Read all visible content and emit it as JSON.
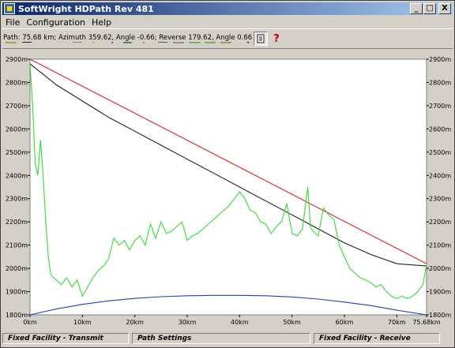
{
  "window": {
    "title": "SoftWright HDPath Rev 481",
    "buttons": {
      "minimize": "_",
      "maximize": "□",
      "close": "X"
    }
  },
  "menu": [
    "File",
    "Configuration",
    "Help"
  ],
  "toolbar": {
    "icons": [
      "new-icon",
      "save-icon",
      "print-icon",
      "edit-icon",
      "record-icon",
      "line-icon",
      "center-icon",
      "expand-icon",
      "locate-icon",
      "map-icon",
      "terrain-icon",
      "layer-a-icon",
      "layer-b-icon",
      "layer-c-icon",
      "zoom-icon",
      "page-icon",
      "help-icon"
    ],
    "help_glyph": "?"
  },
  "path_info": "Path: 75.68 km; Azimuth 359.62, Angle -0.66; Reverse 179.62, Angle 0.66",
  "chart_data": {
    "type": "line",
    "x_unit": "km",
    "y_unit": "m",
    "xlim": [
      0,
      75.68
    ],
    "ylim": [
      1800,
      2900
    ],
    "x_ticks": [
      "0km",
      "10km",
      "20km",
      "30km",
      "40km",
      "50km",
      "60km",
      "70km",
      "75.68km"
    ],
    "y_ticks": [
      "2900m",
      "2800m",
      "2700m",
      "2600m",
      "2500m",
      "2400m",
      "2300m",
      "2200m",
      "2100m",
      "2000m",
      "1900m",
      "1800m"
    ],
    "grid": false,
    "colors": {
      "line_of_sight": "#e02020",
      "earth_curve": "#202020",
      "terrain": "#33dd33",
      "fresnel": "#2040c0"
    },
    "series": [
      {
        "key": "line_of_sight",
        "x": [
          0,
          75.68
        ],
        "y": [
          2900,
          2020
        ]
      },
      {
        "key": "earth_curve",
        "x": [
          0,
          5,
          10,
          15,
          20,
          25,
          30,
          35,
          40,
          45,
          50,
          55,
          60,
          65,
          70,
          75.68
        ],
        "y": [
          2880,
          2790,
          2720,
          2650,
          2590,
          2530,
          2470,
          2410,
          2350,
          2290,
          2230,
          2170,
          2110,
          2060,
          2020,
          2010
        ]
      },
      {
        "key": "terrain",
        "x": [
          0,
          0.5,
          1,
          1.5,
          2,
          2.5,
          3,
          3.5,
          4,
          5,
          6,
          7,
          8,
          9,
          10,
          11,
          12,
          13,
          14,
          15,
          16,
          17,
          18,
          19,
          20,
          21,
          22,
          23,
          24,
          25,
          26,
          27,
          28,
          29,
          30,
          31,
          32,
          33,
          34,
          35,
          36,
          37,
          38,
          39,
          40,
          41,
          42,
          43,
          44,
          45,
          46,
          47,
          48,
          49,
          50,
          51,
          52,
          53,
          53.5,
          54,
          55,
          56,
          57,
          58,
          59,
          60,
          61,
          62,
          63,
          64,
          65,
          66,
          67,
          68,
          69,
          70,
          71,
          72,
          73,
          74,
          75,
          75.68
        ],
        "y": [
          2880,
          2700,
          2450,
          2400,
          2550,
          2400,
          2200,
          2050,
          1970,
          1950,
          1930,
          1960,
          1920,
          1950,
          1880,
          1920,
          1960,
          1990,
          2010,
          2040,
          2130,
          2100,
          2120,
          2080,
          2120,
          2140,
          2100,
          2190,
          2130,
          2200,
          2150,
          2160,
          2180,
          2200,
          2120,
          2140,
          2150,
          2170,
          2190,
          2210,
          2230,
          2250,
          2270,
          2300,
          2330,
          2300,
          2250,
          2240,
          2200,
          2190,
          2150,
          2180,
          2200,
          2280,
          2150,
          2140,
          2170,
          2350,
          2180,
          2160,
          2140,
          2260,
          2230,
          2210,
          2100,
          2050,
          2000,
          1980,
          1960,
          1950,
          1940,
          1920,
          1930,
          1900,
          1880,
          1870,
          1880,
          1870,
          1880,
          1900,
          1930,
          2020
        ]
      },
      {
        "key": "fresnel",
        "x": [
          0,
          5,
          10,
          15,
          20,
          25,
          30,
          35,
          40,
          45,
          50,
          55,
          60,
          65,
          70,
          75.68
        ],
        "y": [
          1800,
          1825,
          1845,
          1860,
          1871,
          1878,
          1882,
          1884,
          1884,
          1882,
          1877,
          1868,
          1855,
          1840,
          1820,
          1800
        ]
      }
    ]
  },
  "footer": {
    "left": "Fixed Facility - Transmit",
    "middle": "Path Settings",
    "right": "Fixed Facility - Receive"
  }
}
